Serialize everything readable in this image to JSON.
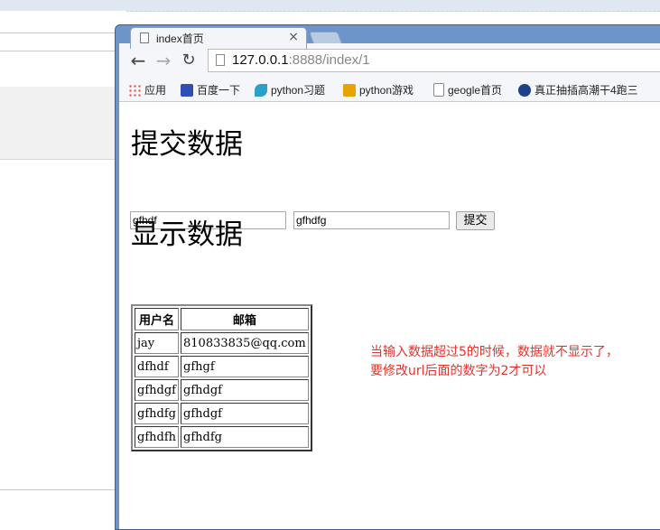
{
  "tab": {
    "title": "index首页",
    "close": "×"
  },
  "toolbar": {
    "back": "←",
    "forward": "→",
    "reload": "↻",
    "url_host": "127.0.0.1",
    "url_rest": ":8888/index/1"
  },
  "bookmarks": [
    {
      "label": "应用",
      "icon": "apps-icon"
    },
    {
      "label": "百度一下",
      "icon": "baidu-icon"
    },
    {
      "label": "python习题",
      "icon": "python-icon"
    },
    {
      "label": "python游戏",
      "icon": "game-icon"
    },
    {
      "label": "geogle首页",
      "icon": "page-icon"
    },
    {
      "label": "真正抽插高潮干4跑三",
      "icon": "globe-icon"
    }
  ],
  "page": {
    "submit_heading": "提交数据",
    "input1_value": "gfhdf",
    "input2_value": "gfhdfg",
    "submit_label": "提交",
    "display_heading": "显示数据",
    "table": {
      "headers": [
        "用户名",
        "邮箱"
      ],
      "rows": [
        [
          "jay",
          "810833835@qq.com"
        ],
        [
          "dfhdf",
          "gfhgf"
        ],
        [
          "gfhdgf",
          "gfhdgf"
        ],
        [
          "gfhdfg",
          "gfhdgf"
        ],
        [
          "gfhdfh",
          "gfhdfg"
        ]
      ]
    }
  },
  "annotation": {
    "line1": "当输入数据超过5的时候，数据就不显示了，",
    "line2": "要修改url后面的数字为2才可以"
  }
}
